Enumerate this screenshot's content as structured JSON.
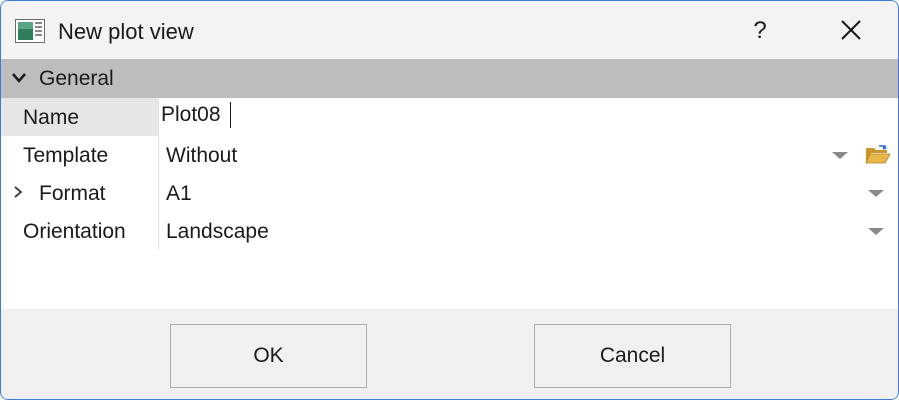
{
  "window": {
    "title": "New plot view",
    "help_label": "?",
    "icons": {
      "app": "plot-view-icon",
      "close": "close-icon"
    }
  },
  "group": {
    "label": "General",
    "expanded": true
  },
  "properties": {
    "name": {
      "label": "Name",
      "value": "Plot08"
    },
    "template": {
      "label": "Template",
      "value": "Without"
    },
    "format": {
      "label": "Format",
      "value": "A1"
    },
    "orientation": {
      "label": "Orientation",
      "value": "Landscape"
    }
  },
  "buttons": {
    "ok": "OK",
    "cancel": "Cancel"
  },
  "colors": {
    "window_border": "#3c7dd8",
    "group_header": "#bdbdbd",
    "selected_label_cell": "#e6e6e6",
    "folder_icon": "#e8b84a"
  }
}
